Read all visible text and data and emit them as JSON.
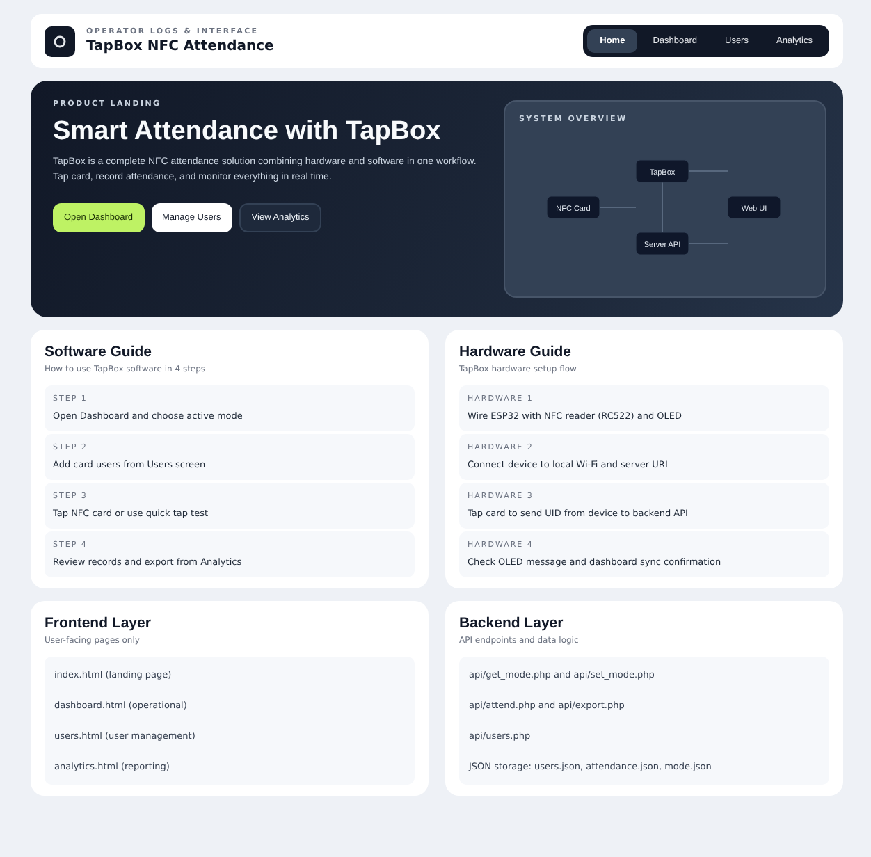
{
  "header": {
    "eyebrow": "OPERATOR LOGS & INTERFACE",
    "title": "TapBox NFC Attendance"
  },
  "nav": [
    {
      "label": "Home",
      "selected": true
    },
    {
      "label": "Dashboard",
      "selected": false
    },
    {
      "label": "Users",
      "selected": false
    },
    {
      "label": "Analytics",
      "selected": false
    }
  ],
  "hero": {
    "eyebrow": "PRODUCT LANDING",
    "title": "Smart Attendance with TapBox",
    "description": "TapBox is a complete NFC attendance solution combining hardware and software in one workflow. Tap card, record attendance, and monitor everything in real time.",
    "buttons": [
      {
        "label": "Open Dashboard",
        "kind": "primary"
      },
      {
        "label": "Manage Users",
        "kind": "light"
      },
      {
        "label": "View Analytics",
        "kind": "dark"
      }
    ],
    "overview": {
      "title": "SYSTEM OVERVIEW",
      "nodes": [
        "NFC Card",
        "TapBox",
        "Server API",
        "Web UI"
      ]
    }
  },
  "guides": [
    {
      "title": "Software Guide",
      "subtitle": "How to use TapBox software in 4 steps",
      "steps": [
        {
          "label": "STEP 1",
          "text": "Open Dashboard and choose active mode"
        },
        {
          "label": "STEP 2",
          "text": "Add card users from Users screen"
        },
        {
          "label": "STEP 3",
          "text": "Tap NFC card or use quick tap test"
        },
        {
          "label": "STEP 4",
          "text": "Review records and export from Analytics"
        }
      ]
    },
    {
      "title": "Hardware Guide",
      "subtitle": "TapBox hardware setup flow",
      "steps": [
        {
          "label": "HARDWARE 1",
          "text": "Wire ESP32 with NFC reader (RC522) and OLED"
        },
        {
          "label": "HARDWARE 2",
          "text": "Connect device to local Wi-Fi and server URL"
        },
        {
          "label": "HARDWARE 3",
          "text": "Tap card to send UID from device to backend API"
        },
        {
          "label": "HARDWARE 4",
          "text": "Check OLED message and dashboard sync confirmation"
        }
      ]
    }
  ],
  "layers": [
    {
      "title": "Frontend Layer",
      "subtitle": "User-facing pages only",
      "items": [
        "index.html (landing page)",
        "dashboard.html (operational)",
        "users.html (user management)",
        "analytics.html (reporting)"
      ]
    },
    {
      "title": "Backend Layer",
      "subtitle": "API endpoints and data logic",
      "items": [
        "api/get_mode.php and api/set_mode.php",
        "api/attend.php and api/export.php",
        "api/users.php",
        "JSON storage: users.json, attendance.json, mode.json"
      ]
    }
  ]
}
